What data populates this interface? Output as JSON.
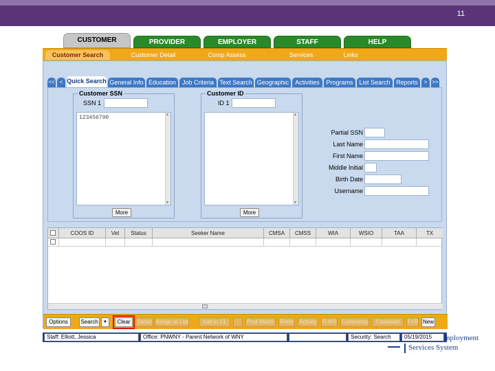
{
  "slide_number": "11",
  "main_tabs": [
    "CUSTOMER",
    "PROVIDER",
    "EMPLOYER",
    "STAFF",
    "HELP"
  ],
  "sub_nav": [
    "Customer Search",
    "Customer Detail",
    "Comp Assess",
    "Services",
    "Links"
  ],
  "inner_tabs": {
    "scroll_first": "<<",
    "scroll_prev": "<",
    "items": [
      "Quick Search",
      "General Info",
      "Education",
      "Job Criteria",
      "Text Search",
      "Geographic",
      "Activities",
      "Programs",
      "List Search",
      "Reports"
    ],
    "scroll_next": ">",
    "scroll_last": ">>"
  },
  "customer_ssn": {
    "title": "Customer SSN",
    "ssn_label": "SSN 1",
    "ssn_value": "",
    "list_value": "123456790",
    "more_label": "More"
  },
  "customer_id": {
    "title": "Customer ID",
    "id_label": "ID 1",
    "id_value": "",
    "more_label": "More"
  },
  "name_fields": [
    {
      "label": "Partial SSN",
      "value": ""
    },
    {
      "label": "Last Name",
      "value": ""
    },
    {
      "label": "First Name",
      "value": ""
    },
    {
      "label": "Middle Initial",
      "value": ""
    },
    {
      "label": "Birth Date",
      "value": ""
    },
    {
      "label": "Username",
      "value": ""
    }
  ],
  "grid": {
    "columns": [
      "COOS ID",
      "Vet",
      "Status",
      "Seeker Name",
      "CMSA",
      "CMSS",
      "WIA",
      "WSIO",
      "TAA",
      "TX"
    ]
  },
  "actions": [
    {
      "label": "Options",
      "enabled": true
    },
    {
      "label": "Search",
      "enabled": true
    },
    {
      "label": "▼",
      "enabled": true
    },
    {
      "label": "Clear",
      "enabled": true
    },
    {
      "label": "Detail",
      "enabled": false
    },
    {
      "label": "Assign to List",
      "enabled": false
    },
    {
      "label": "Add to CL",
      "enabled": false
    },
    {
      "label": "Post Match",
      "enabled": false
    },
    {
      "label": "Refer",
      "enabled": false
    },
    {
      "label": "Activity",
      "enabled": false
    },
    {
      "label": "R-WS",
      "enabled": false
    },
    {
      "label": "Comments",
      "enabled": false
    },
    {
      "label": "Caseload",
      "enabled": false
    },
    {
      "label": "TVR",
      "enabled": false
    },
    {
      "label": "New",
      "enabled": true
    }
  ],
  "status_bar": {
    "staff": "Staff: Elliott, Jessica",
    "office": "Office: PNWNY - Parent Network of WNY",
    "blank1": "",
    "screen": "Security: Search",
    "date": "05/19/2015"
  },
  "logo": {
    "line1": "mployment",
    "line2": "Services System"
  },
  "colors": {
    "header": "#5b3478",
    "tab_green": "#2a8a2a",
    "nav_orange": "#f0a818",
    "panel_blue": "#c9d9ee",
    "status_blue": "#1f3f8a",
    "highlight_red": "#dd1111"
  }
}
